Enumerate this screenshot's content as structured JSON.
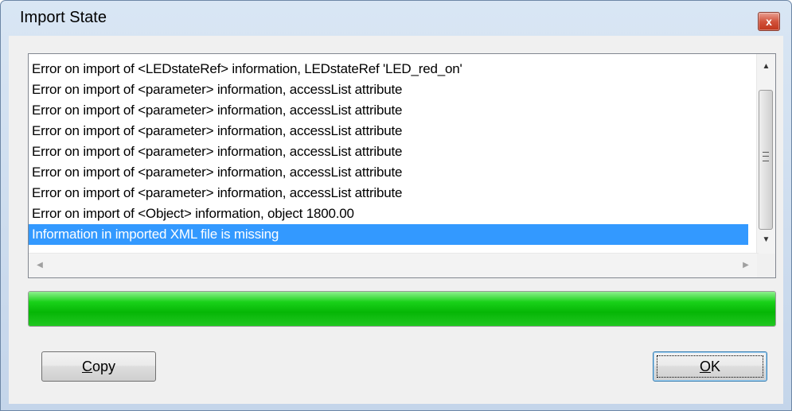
{
  "window": {
    "title": "Import State",
    "close_glyph": "x"
  },
  "log": {
    "items": [
      {
        "text": "Error on import of <LEDstateRef> information, LEDstateRef 'LED_red_on'",
        "selected": false
      },
      {
        "text": "Error on import of <parameter> information, accessList attribute",
        "selected": false
      },
      {
        "text": "Error on import of <parameter> information, accessList attribute",
        "selected": false
      },
      {
        "text": "Error on import of <parameter> information, accessList attribute",
        "selected": false
      },
      {
        "text": "Error on import of <parameter> information, accessList attribute",
        "selected": false
      },
      {
        "text": "Error on import of <parameter> information, accessList attribute",
        "selected": false
      },
      {
        "text": "Error on import of <parameter> information, accessList attribute",
        "selected": false
      },
      {
        "text": "Error on import of <Object> information, object 1800.00",
        "selected": false
      },
      {
        "text": "Information in imported XML file is missing",
        "selected": true
      }
    ],
    "selection_color": "#3399ff",
    "vscroll": {
      "up_icon": "scroll-up-arrow-icon",
      "down_icon": "scroll-down-arrow-icon",
      "grip_icon": "grip-icon"
    },
    "hscroll": {
      "left_icon": "scroll-left-arrow-icon",
      "right_icon": "scroll-right-arrow-icon"
    }
  },
  "progress": {
    "fraction": 1.0,
    "color": "#06b606"
  },
  "buttons": {
    "copy": {
      "mnemonic": "C",
      "rest": "opy"
    },
    "ok": {
      "mnemonic": "O",
      "rest": "K"
    }
  }
}
